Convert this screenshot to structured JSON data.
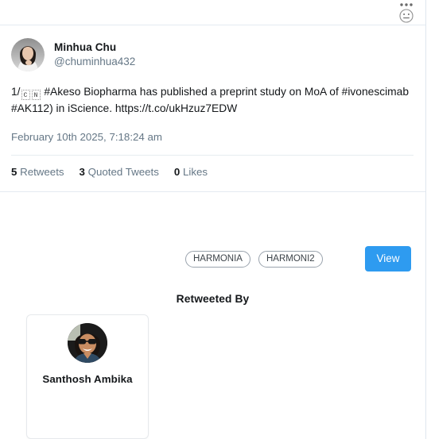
{
  "topbar": {
    "menu_icon": "more-horizontal-icon",
    "emoji_icon": "neutral-face-icon"
  },
  "tweet": {
    "display_name": "Minhua Chu",
    "handle": "@chuminhua432",
    "avatar_alt": "Minhua Chu profile photo",
    "text_prefix": "1/",
    "tofu_1": "C",
    "tofu_2": "N",
    "text_line1": "#Akeso Biopharma has published a preprint study on MoA of",
    "text_line2": "#ivonescimab #AK112) in iScience. https://t.co/ukHzuz7EDW",
    "full_text": "1/🇨🇳 #Akeso Biopharma has published a preprint study on MoA of #ivonescimab #AK112) in iScience. https://t.co/ukHzuz7EDW",
    "date": "February 10th 2025, 7:18:24 am",
    "stats": {
      "retweets_count": "5",
      "retweets_label": "Retweets",
      "quoted_count": "3",
      "quoted_label": "Quoted Tweets",
      "likes_count": "0",
      "likes_label": "Likes"
    }
  },
  "chips": [
    {
      "label": "HARMONIA"
    },
    {
      "label": "HARMONI2"
    }
  ],
  "view_button": {
    "label": "View"
  },
  "retweeted_by": {
    "title": "Retweeted By",
    "users": [
      {
        "name": "Santhosh Ambika",
        "avatar_alt": "Santhosh Ambika profile photo"
      }
    ]
  },
  "colors": {
    "accent_blue": "#2e9bf0",
    "text_primary": "#14171a",
    "text_muted": "#657786",
    "divider": "#e4eaf1",
    "card_border": "#e6e9ec"
  }
}
